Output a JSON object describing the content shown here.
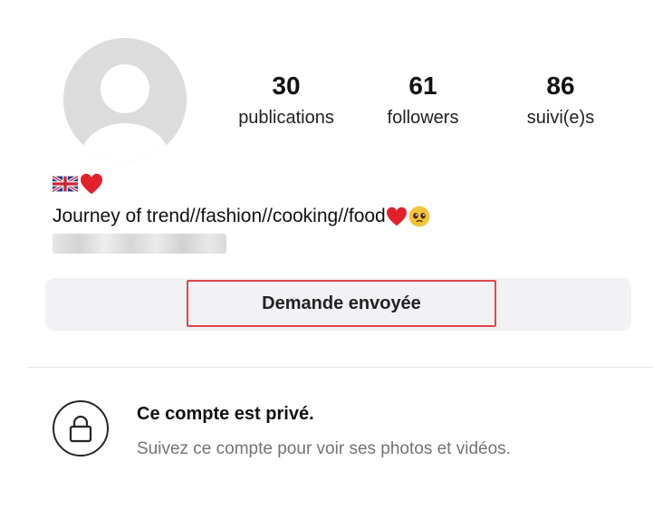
{
  "profile": {
    "avatar_icon": "default-avatar-icon",
    "stats": [
      {
        "value": "30",
        "label": "publications"
      },
      {
        "value": "61",
        "label": "followers"
      },
      {
        "value": "86",
        "label": "suivi(e)s"
      }
    ],
    "bio": {
      "icons": [
        "uk-flag-icon",
        "red-heart-icon"
      ],
      "text": "Journey of trend//fashion//cooking//food",
      "trailing_icons": [
        "red-heart-icon",
        "pleading-face-icon"
      ]
    }
  },
  "actions": {
    "request_label": "Demande envoyée",
    "highlight_color": "#e0474c"
  },
  "private": {
    "icon": "lock-icon",
    "title": "Ce compte est privé.",
    "subtitle": "Suivez ce compte pour voir ses photos et vidéos."
  }
}
